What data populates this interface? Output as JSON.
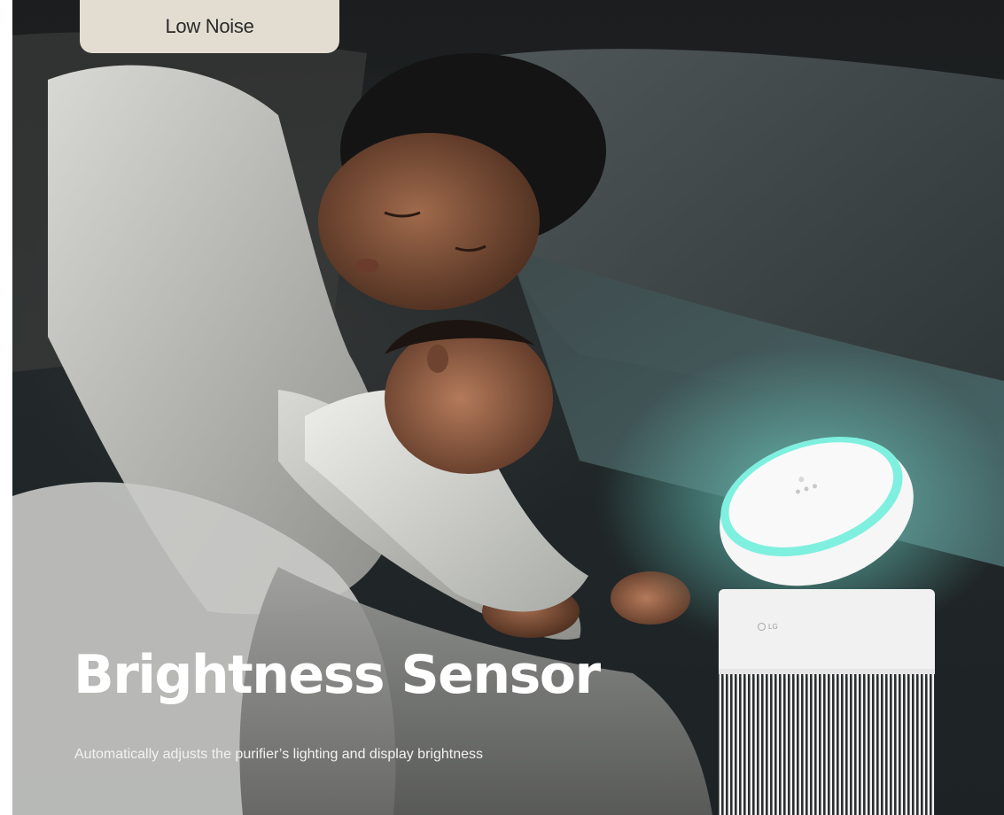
{
  "tab": {
    "label": "Low Noise"
  },
  "hero": {
    "headline": "Brightness Sensor",
    "description": "Automatically adjusts the purifier’s lighting and display brightness"
  },
  "product": {
    "brand": "LG"
  },
  "colors": {
    "tab_background": "#e3ddd1",
    "accent_glow": "#5fe0cf",
    "headline": "#ffffff"
  }
}
